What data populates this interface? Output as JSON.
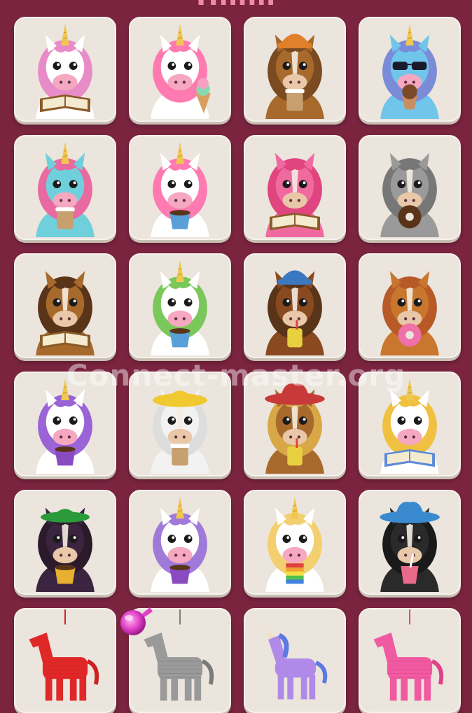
{
  "game": {
    "title_fragment": "Hmm",
    "watermark": "Connect-master.org",
    "colors": {
      "background": "#7a2440",
      "tile": "#ebe5dd",
      "orb": "#e040c8"
    },
    "power_up": {
      "icon": "pink-orb-icon"
    },
    "rows": [
      [
        {
          "name": "unicorn-reading-book",
          "kind": "unicorn",
          "mane": "#e88cc8",
          "face": "#ffffff",
          "item": "book",
          "hat": ""
        },
        {
          "name": "unicorn-ice-cream",
          "kind": "unicorn",
          "mane": "#ff7ab0",
          "face": "#ffffff",
          "item": "icecream",
          "hat": ""
        },
        {
          "name": "horse-beanie-coffee",
          "kind": "horse",
          "mane": "#7a4a20",
          "face": "#a8692d",
          "item": "coffee",
          "hat": "beanie"
        },
        {
          "name": "unicorn-sunglasses-cupcake",
          "kind": "unicorn",
          "mane": "#7a8bd8",
          "face": "#6fc6ea",
          "item": "cupcake",
          "hat": "sunglasses"
        }
      ],
      [
        {
          "name": "unicorn-teal-coffee",
          "kind": "unicorn",
          "mane": "#e86aa0",
          "face": "#6fd0dc",
          "item": "coffee",
          "hat": ""
        },
        {
          "name": "unicorn-white-teacup",
          "kind": "unicorn",
          "mane": "#ff7ab0",
          "face": "#ffffff",
          "item": "cup",
          "hat": ""
        },
        {
          "name": "horse-pink-reading",
          "kind": "horse",
          "mane": "#e0457f",
          "face": "#f06aa0",
          "item": "book",
          "hat": ""
        },
        {
          "name": "horse-grey-donut",
          "kind": "horse",
          "mane": "#777777",
          "face": "#9a9a9a",
          "item": "donut",
          "hat": ""
        }
      ],
      [
        {
          "name": "horse-brown-reading",
          "kind": "horse",
          "mane": "#5a3418",
          "face": "#a8692d",
          "item": "book",
          "hat": ""
        },
        {
          "name": "unicorn-rainbow-mane",
          "kind": "unicorn",
          "mane": "#7ac85a",
          "face": "#ffffff",
          "item": "cup",
          "hat": ""
        },
        {
          "name": "horse-blue-beanie",
          "kind": "horse",
          "mane": "#5a3418",
          "face": "#8a4a20",
          "item": "juice",
          "hat": "beanie-blue"
        },
        {
          "name": "horse-chestnut-donut",
          "kind": "horse",
          "mane": "#b85a28",
          "face": "#c9762f",
          "item": "donut-pink",
          "hat": ""
        }
      ],
      [
        {
          "name": "unicorn-purple-mane",
          "kind": "unicorn",
          "mane": "#9a63d6",
          "face": "#ffffff",
          "item": "cup-purple",
          "hat": ""
        },
        {
          "name": "horse-white-straw-hat",
          "kind": "horse",
          "mane": "#dddddd",
          "face": "#f2f2f2",
          "item": "coffee",
          "hat": "straw"
        },
        {
          "name": "horse-cowboy-denim",
          "kind": "horse",
          "mane": "#d8a848",
          "face": "#a8692d",
          "item": "juice",
          "hat": "cowboy-red"
        },
        {
          "name": "unicorn-rainbow-book",
          "kind": "unicorn",
          "mane": "#f0c040",
          "face": "#ffffff",
          "item": "book-blue",
          "hat": ""
        }
      ],
      [
        {
          "name": "horse-dark-green-hat",
          "kind": "horse",
          "mane": "#2a1a2a",
          "face": "#3a2440",
          "item": "cup-gold",
          "hat": "green"
        },
        {
          "name": "unicorn-lavender-cup",
          "kind": "unicorn",
          "mane": "#a07ad8",
          "face": "#ffffff",
          "item": "cup-purple",
          "hat": ""
        },
        {
          "name": "unicorn-blonde-rainbow-drink",
          "kind": "unicorn",
          "mane": "#f2d070",
          "face": "#ffffff",
          "item": "rainbow",
          "hat": ""
        },
        {
          "name": "horse-black-cowboy",
          "kind": "horse",
          "mane": "#1a1a1a",
          "face": "#2a2a2a",
          "item": "smoothie",
          "hat": "cowboy-blue"
        }
      ],
      [
        {
          "name": "pinata-red-horse",
          "kind": "pinata",
          "mane": "#d02020",
          "face": "#e02828",
          "item": "",
          "hat": ""
        },
        {
          "name": "pinata-grey-donkey",
          "kind": "pinata",
          "mane": "#7a7a7a",
          "face": "#9a9a9a",
          "item": "",
          "hat": ""
        },
        {
          "name": "toy-purple-unicorn",
          "kind": "toy-unicorn",
          "mane": "#5a7ae0",
          "face": "#b08ae8",
          "item": "",
          "hat": ""
        },
        {
          "name": "pinata-pink-horse",
          "kind": "pinata",
          "mane": "#e0408a",
          "face": "#f05aa0",
          "item": "",
          "hat": ""
        }
      ]
    ]
  }
}
